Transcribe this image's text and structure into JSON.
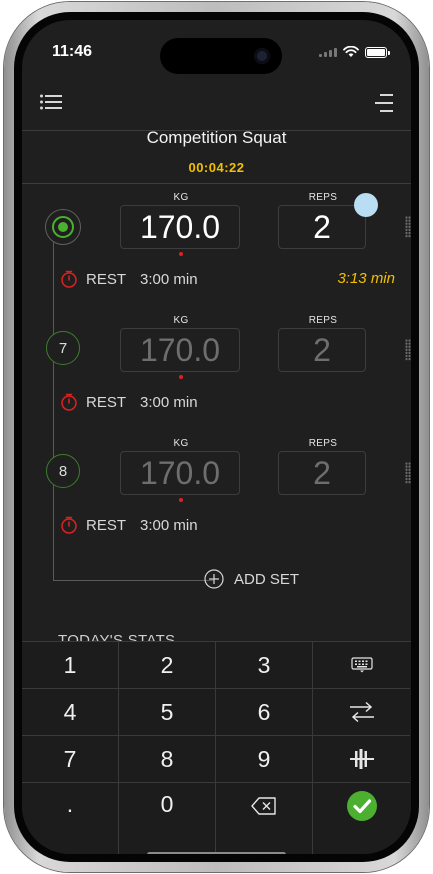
{
  "status_bar": {
    "time": "11:46"
  },
  "exercise": {
    "title": "Competition Squat",
    "elapsed": "00:04:22"
  },
  "columns": {
    "kg_label": "KG",
    "reps_label": "REPS"
  },
  "sets": [
    {
      "marker": "",
      "kg": "170.0",
      "reps": "2",
      "rest_label": "REST",
      "rest_time": "3:00 min",
      "rest_actual": "3:13 min",
      "state": "active"
    },
    {
      "marker": "7",
      "kg": "170.0",
      "reps": "2",
      "rest_label": "REST",
      "rest_time": "3:00 min",
      "state": "pending"
    },
    {
      "marker": "8",
      "kg": "170.0",
      "reps": "2",
      "rest_label": "REST",
      "rest_time": "3:00 min",
      "state": "pending"
    }
  ],
  "add_set_label": "ADD SET",
  "stats_label": "TODAY'S STATS",
  "keypad": {
    "keys": [
      "1",
      "2",
      "3",
      "4",
      "5",
      "6",
      "7",
      "8",
      "9",
      ".",
      "0"
    ],
    "icons": [
      "keyboard-icon",
      "swap-icon",
      "plates-icon",
      "backspace-icon",
      "check-icon"
    ]
  },
  "colors": {
    "accent_yellow": "#f2c000",
    "green": "#4caf2f",
    "red": "#e02020",
    "bubble": "#b9ddf2"
  }
}
